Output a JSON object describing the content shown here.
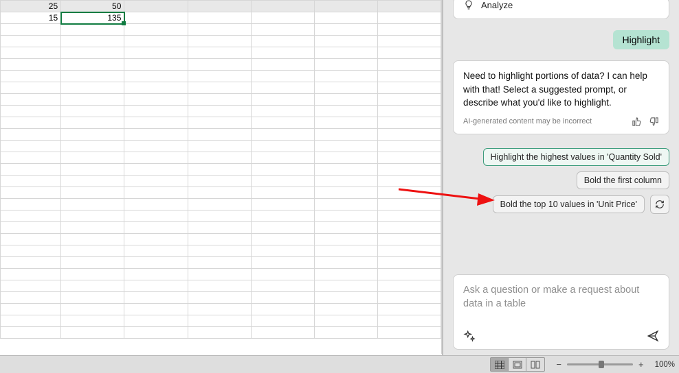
{
  "spreadsheet": {
    "a1": "25",
    "b1": "50",
    "a2": "15",
    "b2": "135"
  },
  "analyze": {
    "label": "Analyze"
  },
  "user_msg": "Highlight",
  "assistant": {
    "text": "Need to highlight portions of data? I can help with that! Select a suggested prompt, or describe what you'd like to highlight.",
    "disclaimer": "AI-generated content may be incorrect"
  },
  "suggestions": {
    "s1": "Highlight the highest values in 'Quantity Sold'",
    "s2": "Bold the first column",
    "s3": "Bold the top 10 values in 'Unit Price'"
  },
  "input": {
    "placeholder": "Ask a question or make a request about data in a table"
  },
  "status": {
    "zoom": "100%"
  }
}
